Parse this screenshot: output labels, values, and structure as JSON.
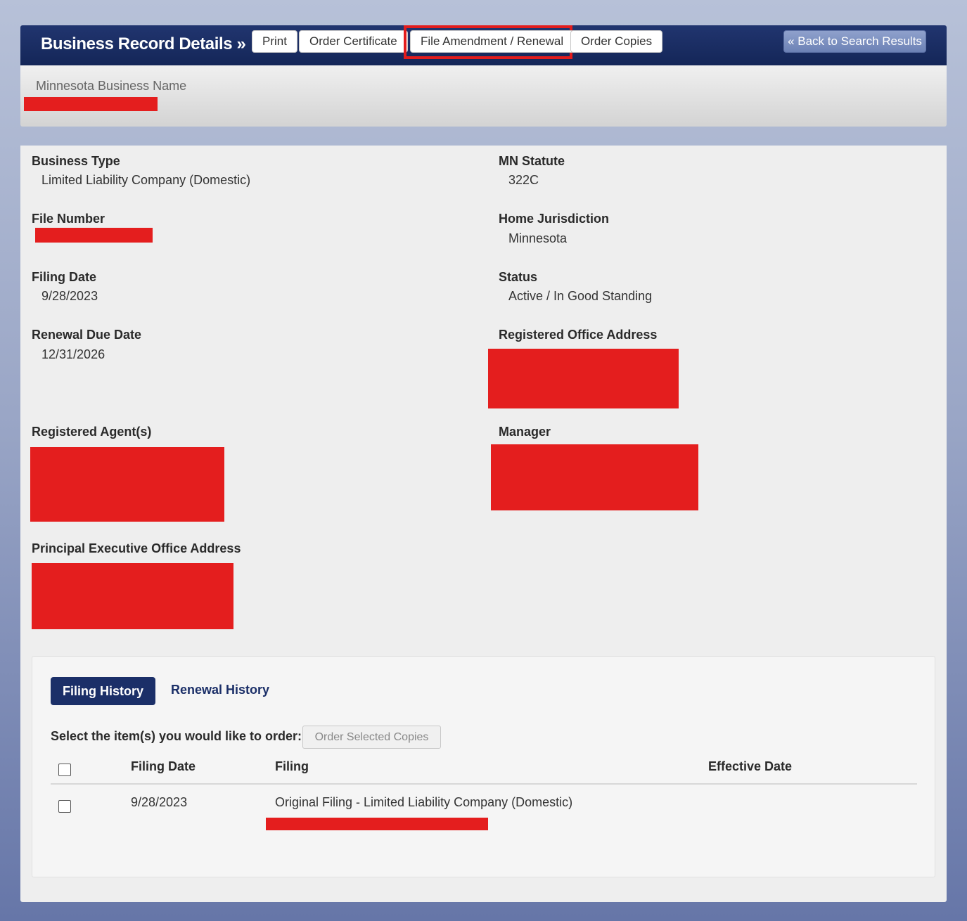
{
  "header": {
    "title": "Business Record Details »",
    "buttons": {
      "print": "Print",
      "order_certificate": "Order Certificate",
      "file_amendment": "File Amendment / Renewal",
      "order_copies": "Order Copies"
    },
    "back": "« Back to Search Results"
  },
  "business_name": {
    "label": "Minnesota Business Name"
  },
  "fields": {
    "business_type": {
      "label": "Business Type",
      "value": "Limited Liability Company (Domestic)"
    },
    "mn_statute": {
      "label": "MN Statute",
      "value": "322C"
    },
    "file_number": {
      "label": "File Number"
    },
    "home_jurisdiction": {
      "label": "Home Jurisdiction",
      "value": "Minnesota"
    },
    "filing_date": {
      "label": "Filing Date",
      "value": "9/28/2023"
    },
    "status": {
      "label": "Status",
      "value": "Active / In Good Standing"
    },
    "renewal_due_date": {
      "label": "Renewal Due Date",
      "value": "12/31/2026"
    },
    "registered_office_address": {
      "label": "Registered Office Address"
    },
    "registered_agents": {
      "label": "Registered Agent(s)"
    },
    "manager": {
      "label": "Manager"
    },
    "principal_executive_office_address": {
      "label": "Principal Executive Office Address"
    }
  },
  "history": {
    "tabs": {
      "filing": "Filing History",
      "renewal": "Renewal History"
    },
    "select_label": "Select the item(s) you would like to order:",
    "order_button": "Order Selected Copies",
    "columns": {
      "filing_date": "Filing Date",
      "filing": "Filing",
      "effective_date": "Effective Date"
    },
    "rows": [
      {
        "filing_date": "9/28/2023",
        "filing": "Original Filing - Limited Liability Company (Domestic)",
        "effective_date": ""
      }
    ]
  },
  "colors": {
    "header_bg": "#1b2f68",
    "redaction": "#e41e1e",
    "highlight_box": "#e31c1c",
    "back_button": "#7a8ec0"
  }
}
